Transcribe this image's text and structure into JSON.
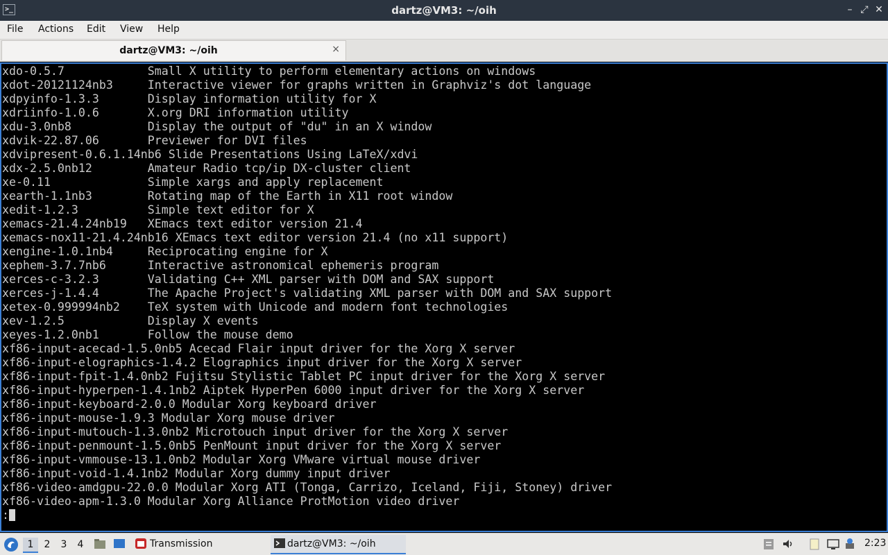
{
  "window": {
    "title": "dartz@VM3: ~/oih",
    "app_icon": "terminal-icon",
    "controls": {
      "minimize": "–",
      "restore": "⤢",
      "close": "✕"
    }
  },
  "menu": {
    "items": [
      "File",
      "Actions",
      "Edit",
      "View",
      "Help"
    ]
  },
  "tab": {
    "label": "dartz@VM3: ~/oih",
    "close": "×"
  },
  "terminal": {
    "lines": [
      "xdo-0.5.7            Small X utility to perform elementary actions on windows",
      "xdot-20121124nb3     Interactive viewer for graphs written in Graphviz's dot language",
      "xdpyinfo-1.3.3       Display information utility for X",
      "xdriinfo-1.0.6       X.org DRI information utility",
      "xdu-3.0nb8           Display the output of \"du\" in an X window",
      "xdvik-22.87.06       Previewer for DVI files",
      "xdvipresent-0.6.1.14nb6 Slide Presentations Using LaTeX/xdvi",
      "xdx-2.5.0nb12        Amateur Radio tcp/ip DX-cluster client",
      "xe-0.11              Simple xargs and apply replacement",
      "xearth-1.1nb3        Rotating map of the Earth in X11 root window",
      "xedit-1.2.3          Simple text editor for X",
      "xemacs-21.4.24nb19   XEmacs text editor version 21.4",
      "xemacs-nox11-21.4.24nb16 XEmacs text editor version 21.4 (no x11 support)",
      "xengine-1.0.1nb4     Reciprocating engine for X",
      "xephem-3.7.7nb6      Interactive astronomical ephemeris program",
      "xerces-c-3.2.3       Validating C++ XML parser with DOM and SAX support",
      "xerces-j-1.4.4       The Apache Project's validating XML parser with DOM and SAX support",
      "xetex-0.999994nb2    TeX system with Unicode and modern font technologies",
      "xev-1.2.5            Display X events",
      "xeyes-1.2.0nb1       Follow the mouse demo",
      "xf86-input-acecad-1.5.0nb5 Acecad Flair input driver for the Xorg X server",
      "xf86-input-elographics-1.4.2 Elographics input driver for the Xorg X server",
      "xf86-input-fpit-1.4.0nb2 Fujitsu Stylistic Tablet PC input driver for the Xorg X server",
      "xf86-input-hyperpen-1.4.1nb2 Aiptek HyperPen 6000 input driver for the Xorg X server",
      "xf86-input-keyboard-2.0.0 Modular Xorg keyboard driver",
      "xf86-input-mouse-1.9.3 Modular Xorg mouse driver",
      "xf86-input-mutouch-1.3.0nb2 Microtouch input driver for the Xorg X server",
      "xf86-input-penmount-1.5.0nb5 PenMount input driver for the Xorg X server",
      "xf86-input-vmmouse-13.1.0nb2 Modular Xorg VMware virtual mouse driver",
      "xf86-input-void-1.4.1nb2 Modular Xorg dummy input driver",
      "xf86-video-amdgpu-22.0.0 Modular Xorg ATI (Tonga, Carrizo, Iceland, Fiji, Stoney) driver",
      "xf86-video-apm-1.3.0 Modular Xorg Alliance ProtMotion video driver"
    ],
    "prompt": ":"
  },
  "taskbar": {
    "start_icon": "start-menu-icon",
    "workspaces": [
      "1",
      "2",
      "3",
      "4"
    ],
    "active_workspace": "1",
    "tasks": [
      {
        "name": "Transmission",
        "icon": "transmission-icon"
      },
      {
        "name": "dartz@VM3: ~/oih",
        "icon": "terminal-icon"
      }
    ],
    "clock": "2:23"
  }
}
